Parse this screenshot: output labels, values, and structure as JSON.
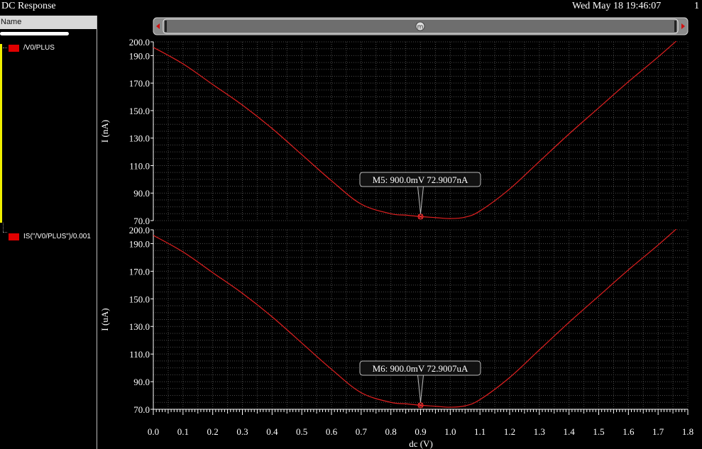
{
  "window": {
    "title": "DC Response",
    "date": "Wed May 18 19:46:07",
    "page": "1"
  },
  "left_panel": {
    "header": "Name",
    "signals": [
      {
        "label": "/V0/PLUS",
        "color": "#e00000"
      },
      {
        "label": "IS(\"/V0/PLUS\")/0.001",
        "color": "#e00000"
      }
    ]
  },
  "colors": {
    "trace": "#e02020",
    "background": "#000000",
    "grid": "#4a4a4a",
    "highlight": "#f0f000"
  },
  "chart_data": [
    {
      "type": "line",
      "title": "",
      "xlabel": "dc (V)",
      "ylabel": "I (nA)",
      "xlim": [
        0.0,
        1.8
      ],
      "ylim": [
        70.0,
        200.0
      ],
      "yticks": [
        "200.0",
        "190.0",
        "170.0",
        "150.0",
        "130.0",
        "110.0",
        "90.0",
        "70.0"
      ],
      "grid": true,
      "series": [
        {
          "name": "/V0/PLUS",
          "x": [
            0.0,
            0.1,
            0.2,
            0.3,
            0.4,
            0.5,
            0.6,
            0.7,
            0.8,
            0.85,
            0.9,
            0.95,
            1.0,
            1.05,
            1.1,
            1.2,
            1.3,
            1.4,
            1.5,
            1.6,
            1.7,
            1.8
          ],
          "y": [
            196,
            184,
            169,
            154,
            137,
            118,
            99,
            82,
            75,
            74,
            72.9,
            72.2,
            71.5,
            72.5,
            77,
            93,
            113,
            133,
            152,
            171,
            189,
            208
          ]
        }
      ],
      "marker": {
        "label": "M5: 900.0mV 72.9007nA",
        "x": 0.9,
        "y": 72.9007
      }
    },
    {
      "type": "line",
      "title": "",
      "xlabel": "dc (V)",
      "ylabel": "I (uA)",
      "xlim": [
        0.0,
        1.8
      ],
      "ylim": [
        70.0,
        200.0
      ],
      "yticks": [
        "200.0",
        "190.0",
        "170.0",
        "150.0",
        "130.0",
        "110.0",
        "90.0",
        "70.0"
      ],
      "xticks": [
        "0.0",
        "0.1",
        "0.2",
        "0.3",
        "0.4",
        "0.5",
        "0.6",
        "0.7",
        "0.8",
        "0.9",
        "1.0",
        "1.1",
        "1.2",
        "1.3",
        "1.4",
        "1.5",
        "1.6",
        "1.7",
        "1.8"
      ],
      "grid": true,
      "series": [
        {
          "name": "IS(\"/V0/PLUS\")/0.001",
          "x": [
            0.0,
            0.1,
            0.2,
            0.3,
            0.4,
            0.5,
            0.6,
            0.7,
            0.8,
            0.85,
            0.9,
            0.95,
            1.0,
            1.05,
            1.1,
            1.2,
            1.3,
            1.4,
            1.5,
            1.6,
            1.7,
            1.8
          ],
          "y": [
            196,
            184,
            169,
            154,
            137,
            118,
            99,
            82,
            75,
            74,
            72.9,
            72.2,
            71.5,
            72.5,
            77,
            93,
            113,
            133,
            152,
            171,
            189,
            208
          ]
        }
      ],
      "marker": {
        "label": "M6: 900.0mV 72.9007uA",
        "x": 0.9,
        "y": 72.9007
      }
    }
  ]
}
